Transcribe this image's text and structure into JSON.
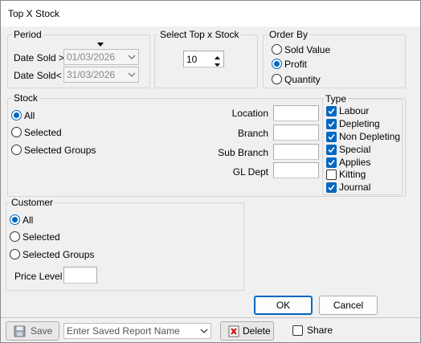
{
  "window": {
    "title": "Top X Stock"
  },
  "period": {
    "label": "Period",
    "date_from_label": "Date Sold >",
    "date_from_value": "01/03/2026",
    "date_to_label": "Date Sold<",
    "date_to_value": "31/03/2026"
  },
  "top_x": {
    "label": "Select Top x Stock",
    "value": "10"
  },
  "order_by": {
    "label": "Order By",
    "options": [
      "Sold Value",
      "Profit",
      "Quantity"
    ],
    "selected": "Profit"
  },
  "stock": {
    "label": "Stock",
    "options": [
      "All",
      "Selected",
      "Selected Groups"
    ],
    "selected": "All",
    "filters": [
      "Location",
      "Branch",
      "Sub Branch",
      "GL Dept"
    ]
  },
  "type": {
    "label": "Type",
    "items": [
      {
        "label": "Labour",
        "checked": true
      },
      {
        "label": "Depleting",
        "checked": true
      },
      {
        "label": "Non Depleting",
        "checked": true
      },
      {
        "label": "Special",
        "checked": true
      },
      {
        "label": "Applies",
        "checked": true
      },
      {
        "label": "Kitting",
        "checked": false
      },
      {
        "label": "Journal",
        "checked": true
      }
    ]
  },
  "customer": {
    "label": "Customer",
    "options": [
      "All",
      "Selected",
      "Selected Groups"
    ],
    "selected": "All",
    "price_level_label": "Price Level",
    "price_level_value": ""
  },
  "actions": {
    "ok_label": "OK",
    "cancel_label": "Cancel"
  },
  "footer": {
    "save_label": "Save",
    "saved_report_placeholder": "Enter Saved Report Name",
    "delete_label": "Delete",
    "share_label": "Share",
    "share_checked": false
  },
  "colors": {
    "accent": "#0067c0",
    "dialog_bg": "#f0f0f0",
    "title_bg": "#ffffff"
  }
}
